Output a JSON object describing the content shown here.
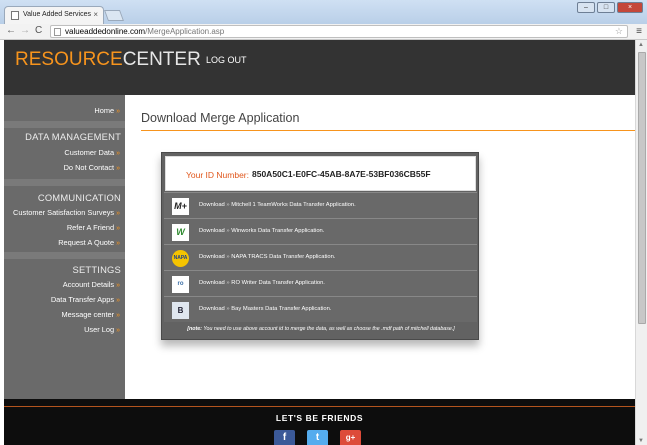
{
  "browser": {
    "tab_title": "Value Added Services",
    "tab_close": "×",
    "url_domain": "valueaddedonline.com",
    "url_path": "/MergeApplication.asp",
    "back_glyph": "←",
    "forward_glyph": "→",
    "reload_glyph": "C",
    "star_glyph": "☆",
    "menu_glyph": "≡",
    "minimize_glyph": "–",
    "maximize_glyph": "□",
    "close_glyph": "×"
  },
  "header": {
    "logo_part1": "RESOURCE",
    "logo_part2": "CENTER",
    "logout": "LOG OUT"
  },
  "sidebar": {
    "arrow": "»",
    "home": "Home",
    "data_management_heading": "DATA MANAGEMENT",
    "customer_data": "Customer Data",
    "do_not_contact": "Do Not Contact",
    "communication_heading": "COMMUNICATION",
    "customer_satisfaction_surveys": "Customer Satisfaction Surveys",
    "refer_a_friend": "Refer A Friend",
    "request_a_quote": "Request A Quote",
    "settings_heading": "SETTINGS",
    "account_details": "Account Details",
    "data_transfer_apps": "Data Transfer Apps",
    "message_center": "Message center",
    "user_log": "User Log"
  },
  "main": {
    "title": "Download Merge Application",
    "id_label": "Your ID Number:",
    "id_value": "850A50C1-E0FC-45AB-8A7E-53BF036CB55F",
    "download_word": "Download",
    "download_sep": "»",
    "downloads": [
      {
        "icon": "mitchell-teamworks-icon",
        "icon_text": "M+",
        "app": "Mitchell 1 TeamWorks Data Transfer Application."
      },
      {
        "icon": "winworks-icon",
        "icon_text": "W",
        "app": "Winworks Data Transfer Application."
      },
      {
        "icon": "napa-tracs-icon",
        "icon_text": "NAPA",
        "app": "NAPA TRACS Data Transfer Application."
      },
      {
        "icon": "ro-writer-icon",
        "icon_text": "ro",
        "app": "RO Writer Data Transfer Application."
      },
      {
        "icon": "bay-masters-icon",
        "icon_text": "B",
        "app": "Bay Masters Data Transfer Application."
      }
    ],
    "note_prefix": "[note:",
    "note_text": "You need to use above account id to merge the data, as well as choose the .mdf path of mitchell database.]"
  },
  "footer": {
    "title": "LET'S BE FRIENDS",
    "facebook": "f",
    "twitter": "t",
    "googleplus": "g+"
  },
  "colors": {
    "accent": "#f7941d",
    "header_bg": "#333333",
    "sidebar_bg": "#6a6a6a",
    "panel_bg": "#626262",
    "id_label": "#e0561b",
    "facebook": "#3b5998",
    "twitter": "#55acee",
    "googleplus": "#dd4b39"
  }
}
